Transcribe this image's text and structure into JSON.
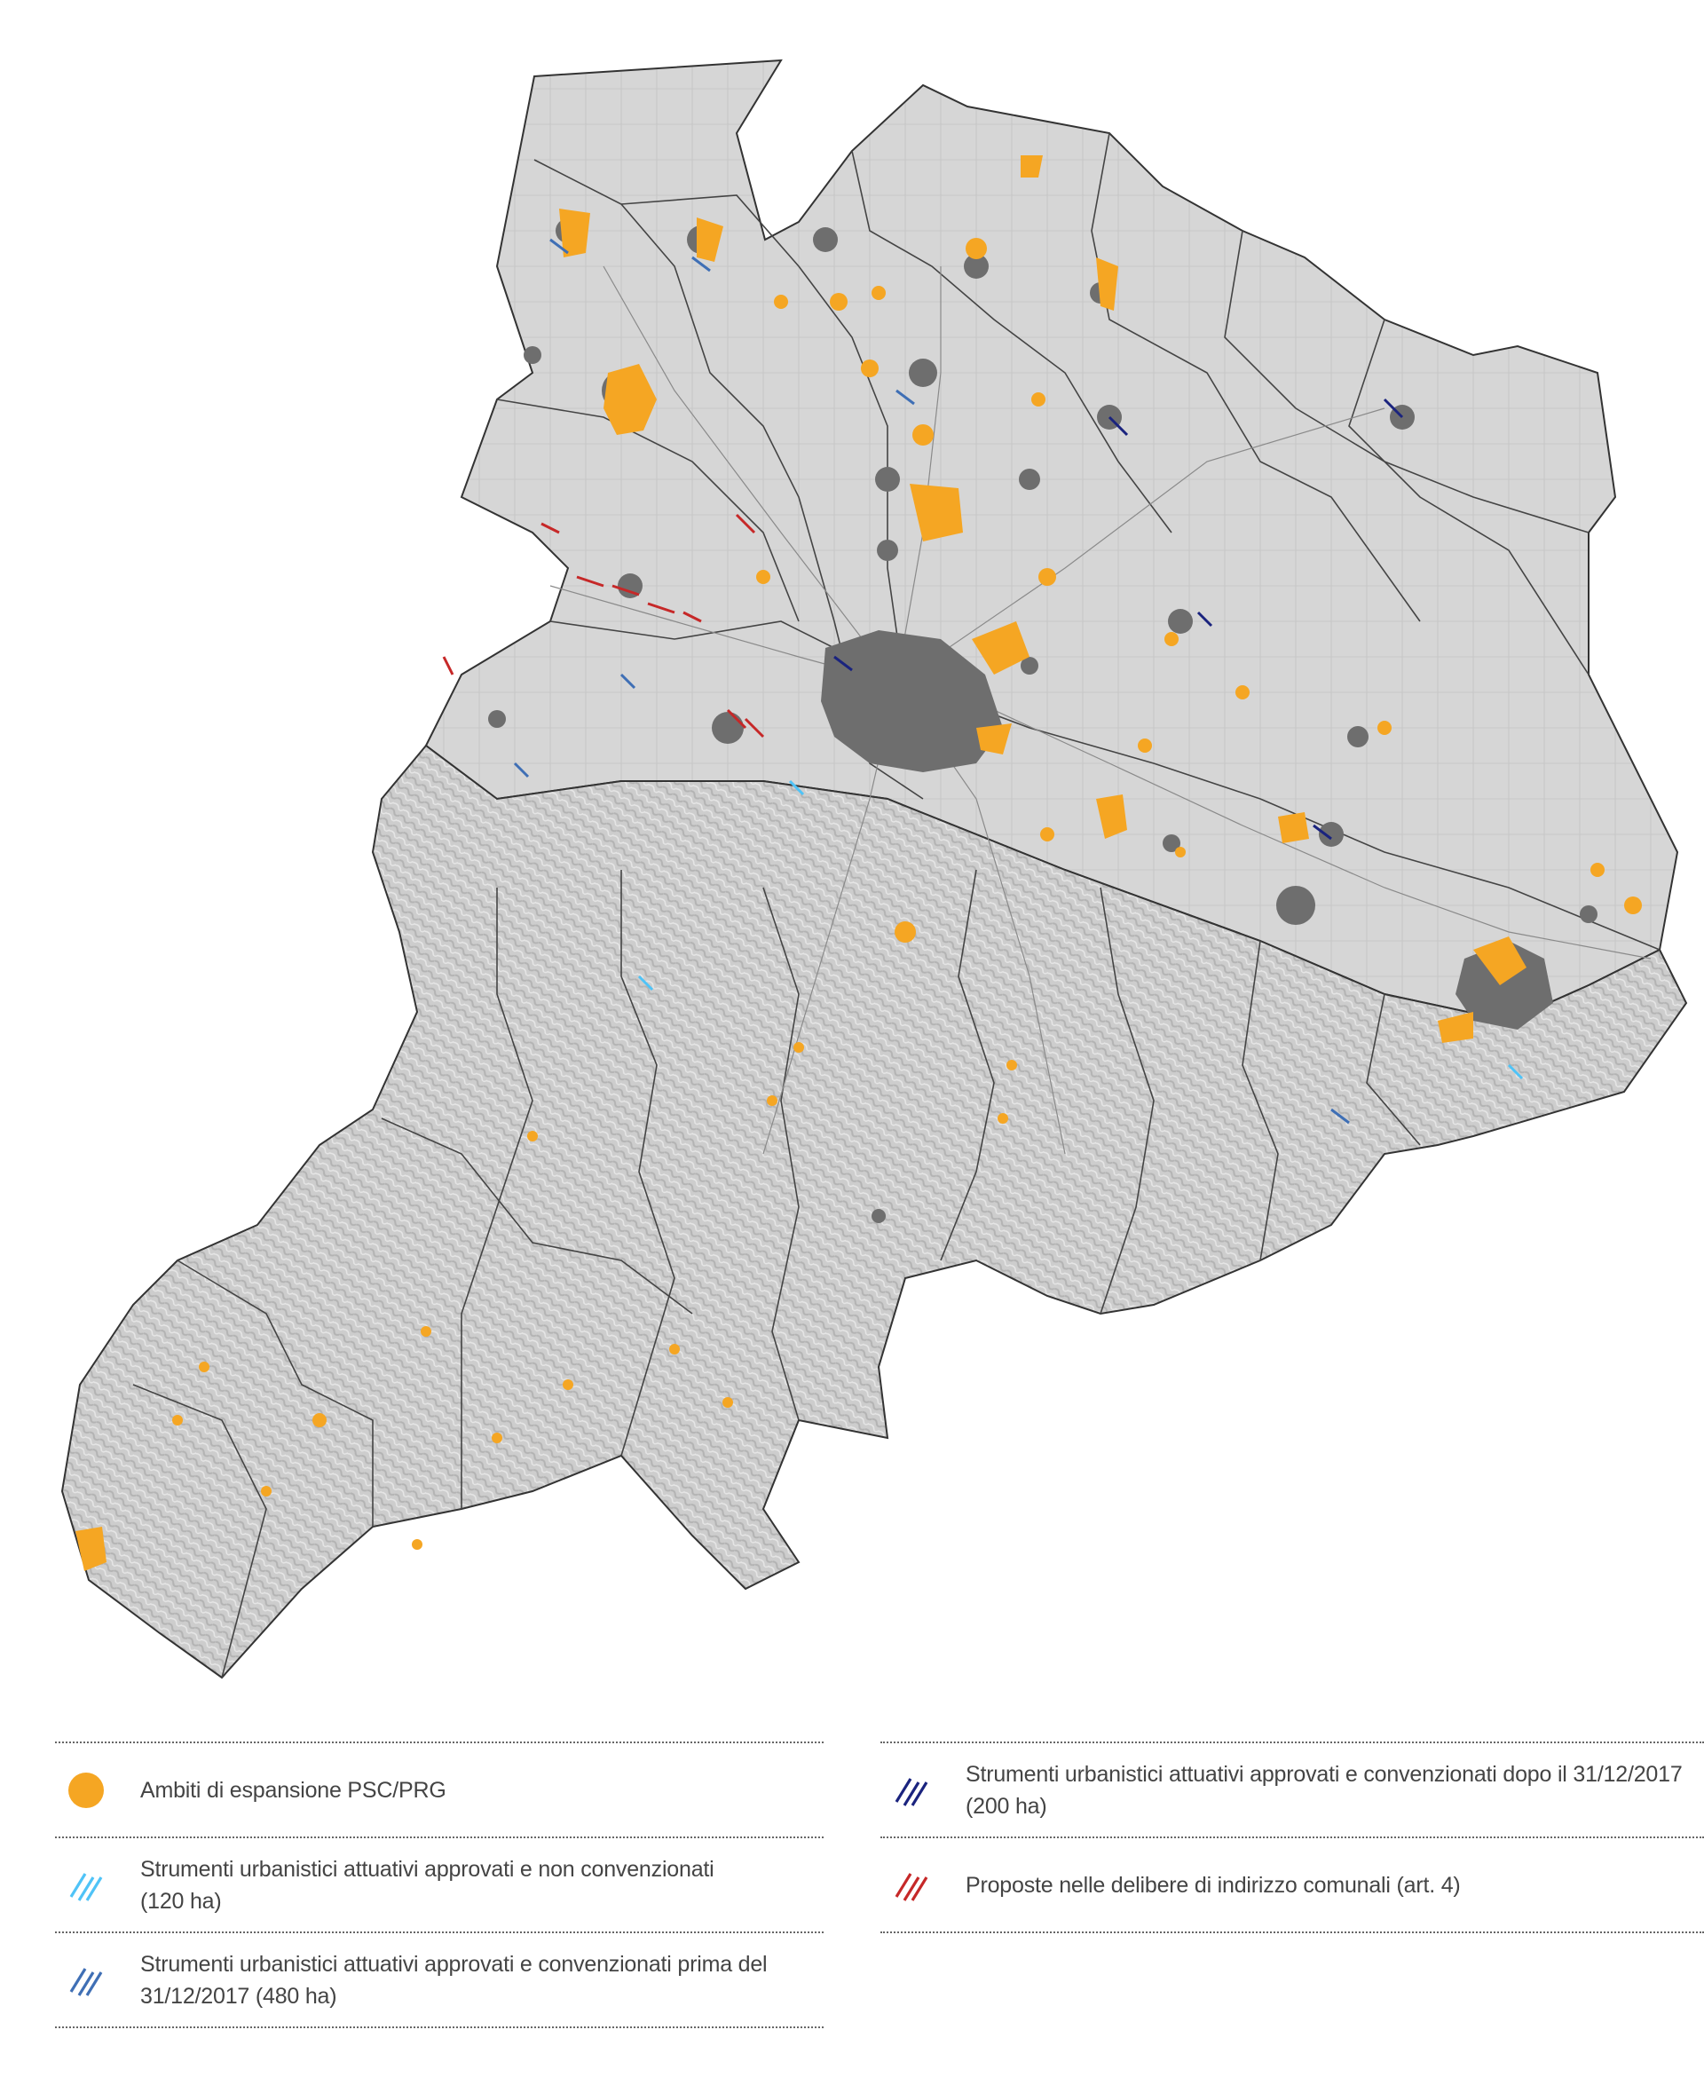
{
  "map": {
    "colors": {
      "plain": "#d4d4d4",
      "hills": "#c9c9c9",
      "boundary": "#333333",
      "urban": "#6e6e6e",
      "expansion": "#f5a623",
      "approved_not_convenzionati": "#4fc3f7",
      "convenzionati_before_2018": "#3f6fb5",
      "convenzionati_after_2017": "#1a237e",
      "delibere_proposals": "#c62828"
    }
  },
  "legend": {
    "left": [
      {
        "symbol": "dot",
        "color": "#f5a623",
        "lines": [
          "Ambiti di espansione PSC/PRG"
        ]
      },
      {
        "symbol": "hatch",
        "color": "#4fc3f7",
        "lines": [
          "Strumenti urbanistici attuativi approvati e non convenzionati",
          "(120 ha)"
        ]
      },
      {
        "symbol": "hatch",
        "color": "#3f6fb5",
        "lines": [
          "Strumenti urbanistici attuativi approvati e convenzionati prima del",
          "31/12/2017 (480 ha)"
        ]
      }
    ],
    "right": [
      {
        "symbol": "hatch",
        "color": "#1a237e",
        "lines": [
          "Strumenti urbanistici attuativi approvati e convenzionati dopo il 31/12/2017",
          "(200 ha)"
        ]
      },
      {
        "symbol": "hatch",
        "color": "#c62828",
        "lines": [
          "Proposte nelle delibere di indirizzo comunali (art. 4)"
        ]
      }
    ]
  }
}
